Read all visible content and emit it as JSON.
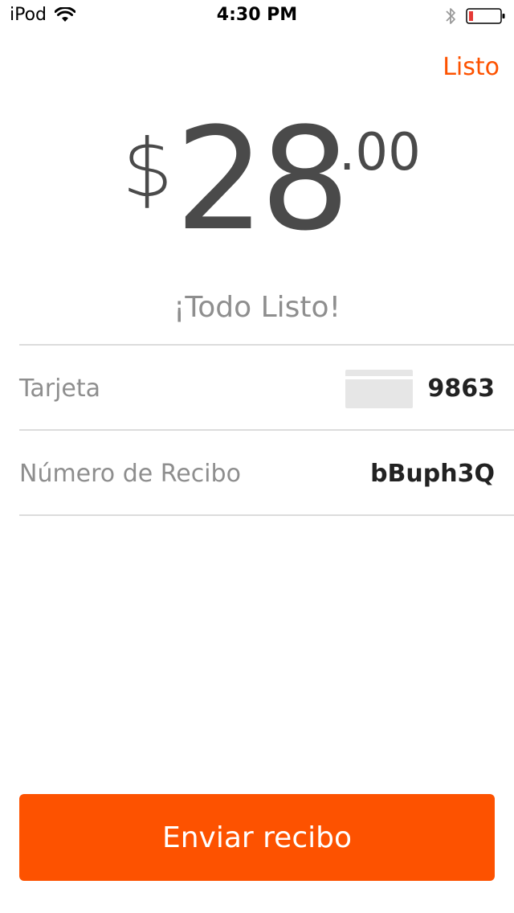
{
  "status_bar": {
    "device": "iPod",
    "time": "4:30 PM"
  },
  "header": {
    "done_label": "Listo"
  },
  "amount": {
    "currency": "$",
    "whole": "28",
    "cents": ".00"
  },
  "status_message": "¡Todo Listo!",
  "details": [
    {
      "label": "Tarjeta",
      "value": "9863",
      "icon": "card-icon"
    },
    {
      "label": "Número de Recibo",
      "value": "bBuph3Q"
    }
  ],
  "primary_action": {
    "label": "Enviar recibo"
  },
  "colors": {
    "accent": "#fd5200",
    "amount_text": "#4a4a4a",
    "muted_text": "#8e8e8e",
    "battery_low": "#e53935"
  }
}
